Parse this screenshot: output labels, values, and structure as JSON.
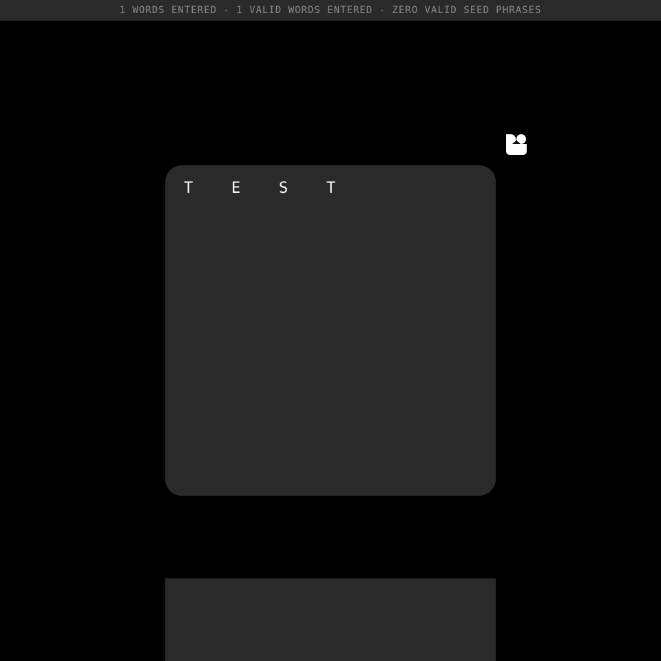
{
  "status_bar": {
    "text": "1 WORDS ENTERED - 1 VALID WORDS ENTERED - ZERO VALID SEED PHRASES"
  },
  "logo": {
    "icon": "app-logo-icon",
    "color": "#ffffff"
  },
  "editor": {
    "word": "TEST",
    "letters": [
      "T",
      "E",
      "S",
      "T"
    ]
  },
  "colors": {
    "background": "#000000",
    "panel": "#2a2a2a",
    "status_text": "#8a8a8a",
    "text": "#ffffff"
  }
}
